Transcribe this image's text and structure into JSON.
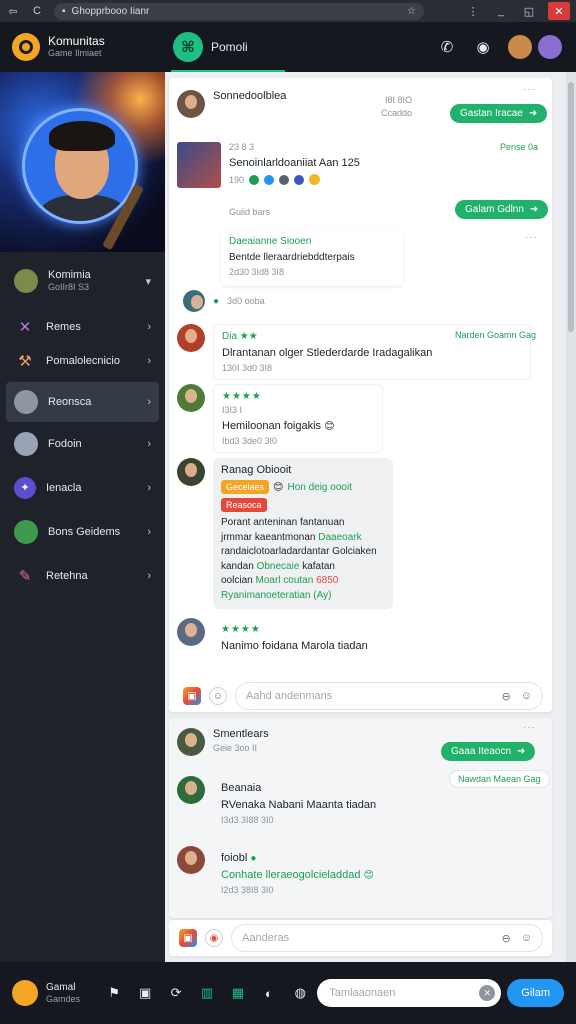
{
  "browser": {
    "url": "Ghopprbooo Iianr",
    "back": "⇦",
    "refresh": "C",
    "star": "☆",
    "ctl_more": "⋮",
    "ctl_min": "_",
    "ctl_max": "◱",
    "ctl_close": "✕"
  },
  "header": {
    "brand_title": "Komunitas",
    "brand_sub": "Game Ilmiaet",
    "active_tab": "Pomoli",
    "call_icon": "✆",
    "alert_icon": "◉"
  },
  "sidebar": {
    "items": [
      {
        "label": "Komimia",
        "sub": "GoIIr8I S3",
        "icon": "avatar",
        "chev": "▾"
      },
      {
        "label": "Remes",
        "icon": "✕",
        "chev": "›"
      },
      {
        "label": "Pomalolecnicio",
        "icon": "⚒",
        "chev": "›"
      },
      {
        "label": "Reonsca",
        "icon": "avatar",
        "chev": "›"
      },
      {
        "label": "Fodoin",
        "icon": "avatar",
        "chev": "›"
      },
      {
        "label": "Ienacla",
        "icon": "✦",
        "chev": "›"
      },
      {
        "label": "Bons Geidems",
        "icon": "avatar",
        "chev": "›"
      },
      {
        "label": "Retehna",
        "icon": "✎",
        "chev": "›"
      }
    ]
  },
  "feed": {
    "m1": {
      "name": "Sonnedoolblea",
      "meta_a": "I8I 8IO",
      "meta_b": "Ccaddo",
      "btn": "Gastan Iracae"
    },
    "m2": {
      "meta": "23 8 3",
      "text": "Senoinlarldoaniiat Aan  125",
      "meta2": "190",
      "link": "Pense 0a"
    },
    "m3": {
      "meta": "Guiid bars",
      "btn": "Galam Gdlnn"
    },
    "m4": {
      "name": "Daeaianne Siooen",
      "text": "Bentde lleraardriebddterpais",
      "meta": "2d30 3Id8 3I8"
    },
    "m5": {
      "meta": "3d0 ooba"
    },
    "m6": {
      "name": "Dia ★★",
      "text": "Dlrantanan olger Stlederdarde Iradagalikan",
      "meta": "130I 3d0 3I8",
      "link": "Narden Goamn Gag"
    },
    "m7": {
      "stars": "★★★★",
      "meta": "I3I3 I",
      "text": "Hemiloonan foigakis",
      "meta2": "Ibd3 3de0 3I0"
    },
    "m8": {
      "name": "Ranag Obiooit",
      "tag1": "Gecelaes",
      "inline": "Hon deig oooit",
      "tag2": "Reasoca",
      "line1": "Porant anteninan fantanuan",
      "line2": "jrmmar kaeantmonan",
      "line2b": "Daaeoark",
      "line3": "randaiclotoarladardantar Golciaken",
      "line4": "kandan",
      "line4b": "Obnecaie",
      "line4c": "kafatan",
      "line5": "oolcian",
      "line5b": "Moarl coutan",
      "line5c": "6850",
      "line6": "Ryanimanoeteratian (Ay)"
    },
    "m9": {
      "stars": "★★★★",
      "text": "Nanimo foidana Marola tiadan"
    },
    "composer1": {
      "placeholder": "Aahd andenmans",
      "icon_a": "⊖",
      "icon_b": "☺"
    },
    "m10": {
      "name": "Smentlears",
      "meta": "Geie 3oo II",
      "btn": "Gaaa Iteaocn",
      "link": "Nawdan Maean Gag"
    },
    "m11": {
      "name": "Beanaia",
      "text": "RVenaka Nabani Maanta tiadan",
      "meta": "I3d3 3I88 3I0"
    },
    "m12": {
      "name": "foiobl",
      "text": "Conhate lleraeogolcieladdad",
      "meta": "I2d3 38I8 3I0"
    },
    "composer2": {
      "placeholder": "Aanderas",
      "icon_a": "⊖",
      "icon_b": "☺"
    }
  },
  "bottom": {
    "user_title": "Gamal",
    "user_sub": "Gamdes",
    "icons": [
      "⚑",
      "▣",
      "⟳",
      "▥",
      "▦",
      "◐",
      "◍"
    ],
    "search_placeholder": "Tamlaaonaen",
    "search_btn": "Gilam",
    "clear": "✕"
  },
  "colors": {
    "accent": "#20b26b",
    "primary": "#2196f3",
    "sidebar": "#1e222a"
  }
}
